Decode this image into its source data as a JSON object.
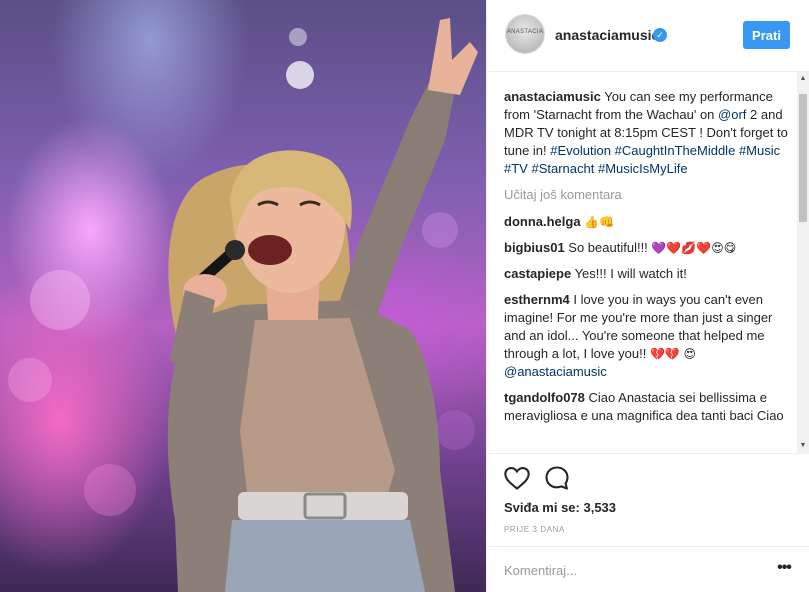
{
  "post": {
    "image_alt": "Singer performing on stage with microphone"
  },
  "header": {
    "avatar_text": "ANASTACIA",
    "username": "anastaciamusic",
    "verified_icon": "✓",
    "follow_label": "Prati"
  },
  "caption": {
    "username": "anastaciamusic",
    "text_1": " You can see my performance from 'Starnacht from the Wachau' on ",
    "mention_orf": "@orf",
    "text_2": " 2 and MDR TV tonight at 8:15pm CEST ! Don't forget to tune in! ",
    "tag_1": "#Evolution",
    "tag_2": "#CaughtInTheMiddle",
    "tag_3": "#Music",
    "tag_4": "#TV",
    "tag_5": "#Starnacht",
    "tag_6": "#MusicIsMyLife"
  },
  "load_more": "Učitaj još komentara",
  "comments": [
    {
      "username": "donna.helga",
      "text": " ",
      "emoji": "👍👊"
    },
    {
      "username": "bigbius01",
      "text": " So beautiful!!! ",
      "emoji": "💜❤️💋❤️😍😋"
    },
    {
      "username": "castapiepe",
      "text": " Yes!!! I will watch it!",
      "emoji": ""
    },
    {
      "username": "esthernm4",
      "text": " I love you in ways you can't even imagine! For me you're more than just a singer and an idol... You're someone that helped me through a lot, I love you!! ",
      "emoji": "💔💔",
      "emoji_2": "😍",
      "mention": "@anastaciamusic"
    },
    {
      "username": "tgandolfo078",
      "text": " Ciao Anastacia sei bellissima e meravigliosa e una magnifica dea tanti baci Ciao",
      "emoji": ""
    }
  ],
  "actions": {
    "heart_icon": "heart-outline",
    "comment_icon": "speech-bubble",
    "likes": "Sviđa mi se: 3,533",
    "time": "PRIJE 3 DANA"
  },
  "add_comment": {
    "placeholder": "Komentiraj...",
    "more_label": "•••"
  },
  "colors": {
    "accent": "#3897f0",
    "link": "#003569",
    "muted": "#999999"
  }
}
